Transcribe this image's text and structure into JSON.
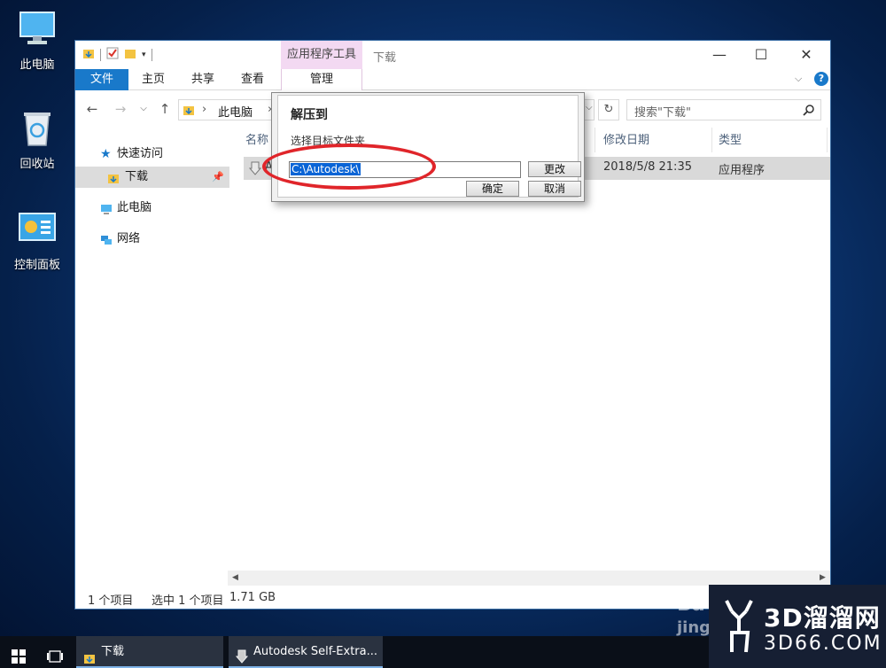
{
  "desktop": {
    "icons": [
      {
        "label": "此电脑",
        "icon": "computer-icon"
      },
      {
        "label": "回收站",
        "icon": "recycle-bin-icon"
      },
      {
        "label": "控制面板",
        "icon": "control-panel-icon"
      }
    ]
  },
  "window": {
    "context_tab_group": "应用程序工具",
    "title": "下载",
    "controls": {
      "minimize": "—",
      "maximize": "☐",
      "close": "✕"
    },
    "ribbon_tabs": [
      "文件",
      "主页",
      "共享",
      "查看",
      "管理"
    ],
    "address": {
      "root": "此电脑",
      "sep": "›"
    },
    "search_placeholder": "搜索\"下载\"",
    "nav": {
      "quick_access": "快速访问",
      "downloads": "下载",
      "this_pc": "此电脑",
      "network": "网络"
    },
    "columns": {
      "name": "名称",
      "modified": "修改日期",
      "type": "类型"
    },
    "file": {
      "name_initial": "A",
      "modified": "2018/5/8 21:35",
      "type": "应用程序"
    },
    "status": {
      "count": "1 个项目",
      "selected": "选中 1 个项目",
      "size": "1.71 GB"
    }
  },
  "dialog": {
    "title": "解压到",
    "subtitle": "选择目标文件夹",
    "path_value": "C:\\Autodesk\\",
    "change_button": "更改",
    "ok_button": "确定",
    "cancel_button": "取消"
  },
  "taskbar": {
    "explorer_label": "下载",
    "app_label": "Autodesk Self-Extra..."
  },
  "watermark": {
    "brand": "3D溜溜网",
    "domain": "3D66.COM",
    "ghost": "Ba",
    "ghost2": "jing"
  },
  "colors": {
    "accent": "#1979ca",
    "context_tab": "#f3d9f2",
    "annotation": "#e0252a",
    "selection": "#0a64d6"
  }
}
